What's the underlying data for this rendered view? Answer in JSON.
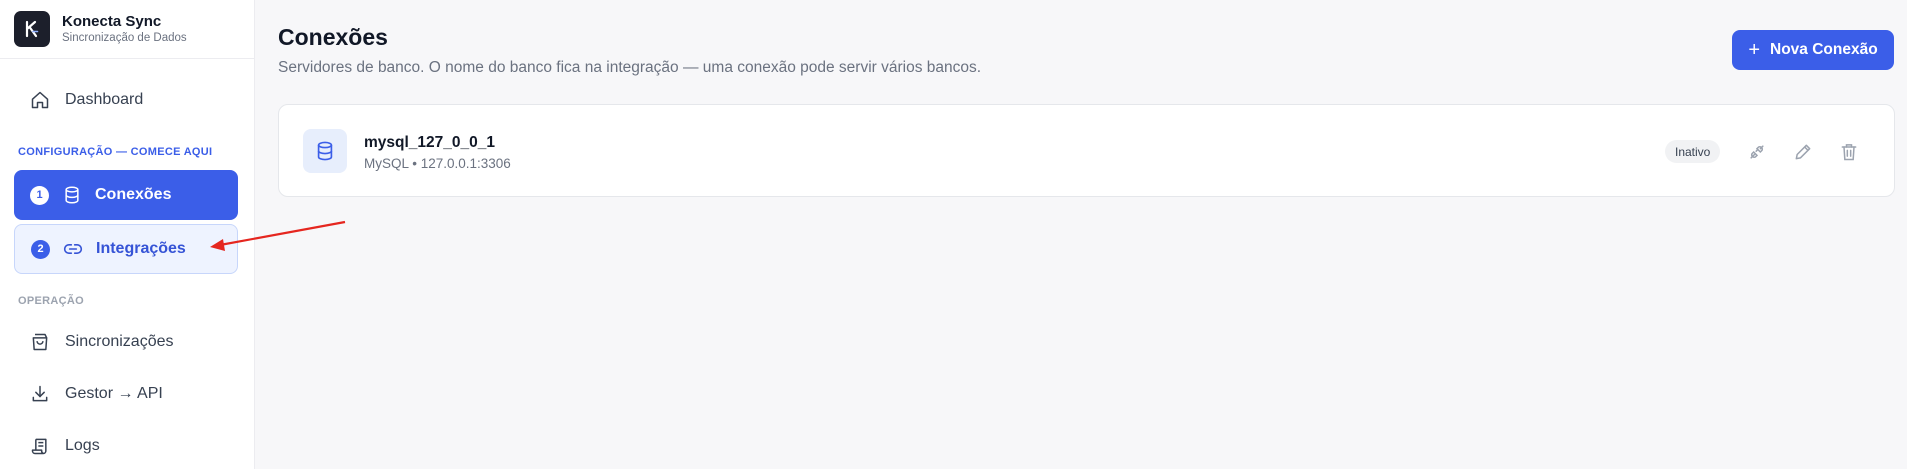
{
  "brand": {
    "name": "Konecta Sync",
    "subtitle": "Sincronização de Dados",
    "logo_letter": "K"
  },
  "sidebar": {
    "dashboard": "Dashboard",
    "config_section": "CONFIGURAÇÃO — COMECE AQUI",
    "config_items": [
      {
        "step": "1",
        "label": "Conexões",
        "icon": "database-icon"
      },
      {
        "step": "2",
        "label": "Integrações",
        "icon": "link-icon"
      }
    ],
    "operation_section": "OPERAÇÃO",
    "operation_items": [
      {
        "label": "Sincronizações",
        "icon": "shopping-bag-icon"
      },
      {
        "label": "Gestor → API",
        "icon": "download-icon"
      },
      {
        "label": "Logs",
        "icon": "scroll-icon"
      }
    ]
  },
  "main": {
    "title": "Conexões",
    "subtitle": "Servidores de banco. O nome do banco fica na integração — uma conexão pode servir vários bancos.",
    "new_button": "Nova Conexão"
  },
  "connections": [
    {
      "name": "mysql_127_0_0_1",
      "meta": "MySQL • 127.0.0.1:3306",
      "status": "Inativo"
    }
  ],
  "colors": {
    "accent": "#3b5ee8",
    "annotation_arrow": "#e5261f"
  }
}
